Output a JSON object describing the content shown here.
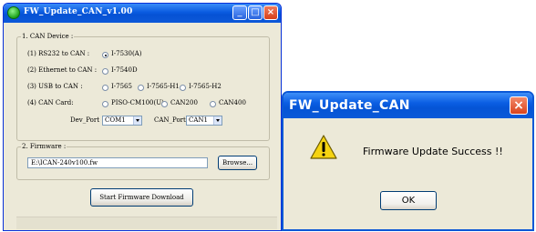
{
  "main_window": {
    "title": "FW_Update_CAN_v1.00",
    "min_glyph": "_",
    "max_glyph": "□",
    "close_glyph": "×",
    "can_device": {
      "legend": "1. CAN Device :",
      "rows": [
        {
          "label": "(1) RS232 to CAN :",
          "options": [
            {
              "label": "I-7530(A)",
              "selected": true
            }
          ]
        },
        {
          "label": "(2) Ethernet to CAN :",
          "options": [
            {
              "label": "I-7540D",
              "selected": false
            }
          ]
        },
        {
          "label": "(3) USB to CAN :",
          "options": [
            {
              "label": "I-7565",
              "selected": false
            },
            {
              "label": "I-7565-H1",
              "selected": false
            },
            {
              "label": "I-7565-H2",
              "selected": false
            }
          ]
        },
        {
          "label": "(4) CAN Card:",
          "options": [
            {
              "label": "PISO-CM100(U)",
              "selected": false
            },
            {
              "label": "CAN200",
              "selected": false
            },
            {
              "label": "CAN400",
              "selected": false
            }
          ]
        }
      ],
      "dev_port_label": "Dev_Port :",
      "dev_port_value": "COM1",
      "can_port_label": "CAN_Port :",
      "can_port_value": "CAN1"
    },
    "firmware": {
      "legend": "2. Firmware :",
      "path_value": "E:\\ICAN-240v100.fw",
      "browse_label": "Browse..."
    },
    "start_button_label": "Start Firmware Download"
  },
  "dialog": {
    "title": "FW_Update_CAN",
    "close_glyph": "×",
    "icon": "warning-icon",
    "message": "Firmware Update Success !!",
    "ok_label": "OK"
  },
  "colors": {
    "titlebar_blue": "#0a5be0",
    "window_face": "#ece9d8",
    "close_red": "#d6401a",
    "warning_yellow": "#f5d311"
  }
}
